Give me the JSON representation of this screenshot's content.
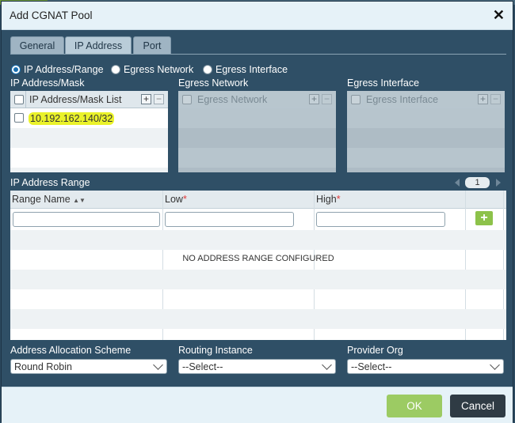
{
  "dialog": {
    "title": "Add CGNAT Pool"
  },
  "tabs": [
    {
      "label": "General",
      "active": false
    },
    {
      "label": "IP Address",
      "active": true
    },
    {
      "label": "Port",
      "active": false
    }
  ],
  "source_options": [
    {
      "label": "IP Address/Range",
      "selected": true
    },
    {
      "label": "Egress Network",
      "selected": false
    },
    {
      "label": "Egress Interface",
      "selected": false
    }
  ],
  "ip_mask": {
    "section_label": "IP Address/Mask",
    "column_header": "IP Address/Mask List",
    "rows": [
      "10.192.162.140/32"
    ]
  },
  "egress_network": {
    "section_label": "Egress Network",
    "column_header": "Egress Network"
  },
  "egress_interface": {
    "section_label": "Egress Interface",
    "column_header": "Egress Interface"
  },
  "range": {
    "section_label": "IP Address Range",
    "page": "1",
    "columns": {
      "name": "Range Name",
      "low": "Low",
      "high": "High",
      "required_marker": "*"
    },
    "add_symbol": "+",
    "empty_message": "NO ADDRESS RANGE CONFIGURED"
  },
  "allocation": {
    "label": "Address Allocation Scheme",
    "value": "Round Robin"
  },
  "routing": {
    "label": "Routing Instance",
    "value": "--Select--"
  },
  "provider": {
    "label": "Provider Org",
    "value": "--Select--"
  },
  "footer": {
    "ok": "OK",
    "cancel": "Cancel"
  },
  "colors": {
    "dialog_bg": "#2f4f66",
    "ok_button": "#9ccb63",
    "cancel_button": "#2f3b44",
    "highlight": "#eaf22a",
    "add_button": "#8dc24a"
  }
}
